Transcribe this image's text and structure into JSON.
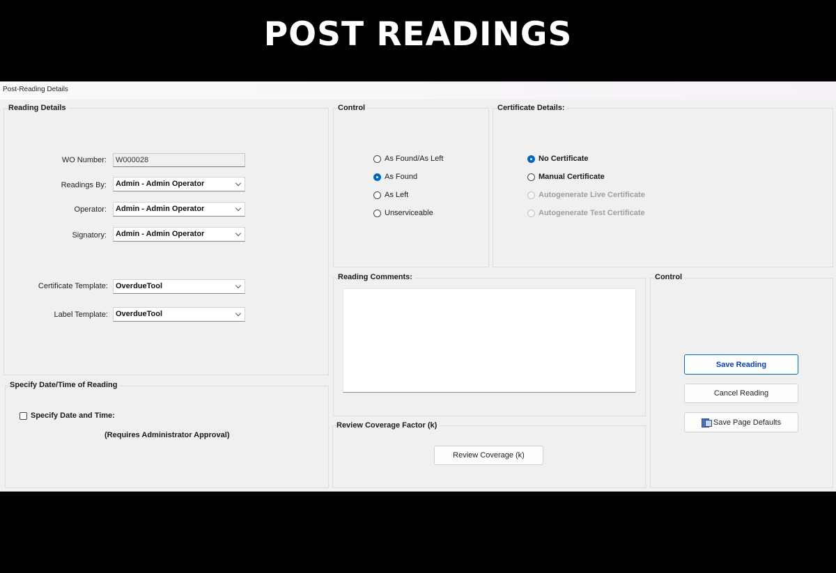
{
  "banner": {
    "title": "POST READINGS"
  },
  "window": {
    "title": "Post-Reading Details"
  },
  "reading_details": {
    "title": "Reading Details",
    "wo_number": {
      "label": "WO Number:",
      "value": "W000028"
    },
    "readings_by": {
      "label": "Readings By:",
      "value": "Admin - Admin Operator"
    },
    "operator": {
      "label": "Operator:",
      "value": "Admin - Admin Operator"
    },
    "signatory": {
      "label": "Signatory:",
      "value": "Admin - Admin Operator"
    },
    "certificate_template": {
      "label": "Certificate Template:",
      "value": "OverdueTool"
    },
    "label_template": {
      "label": "Label Template:",
      "value": "OverdueTool"
    }
  },
  "control_options": {
    "title": "Control",
    "options": [
      {
        "label": "As Found/As Left",
        "checked": false
      },
      {
        "label": "As Found",
        "checked": true
      },
      {
        "label": "As Left",
        "checked": false
      },
      {
        "label": "Unserviceable",
        "checked": false
      }
    ]
  },
  "certificate_details": {
    "title": "Certificate Details:",
    "options": [
      {
        "label": "No Certificate",
        "checked": true,
        "enabled": true
      },
      {
        "label": "Manual Certificate",
        "checked": false,
        "enabled": true
      },
      {
        "label": "Autogenerate Live Certificate",
        "checked": false,
        "enabled": false
      },
      {
        "label": "Autogenerate Test Certificate",
        "checked": false,
        "enabled": false
      }
    ]
  },
  "datetime": {
    "title": "Specify Date/Time of Reading",
    "checkbox_label": "Specify Date and Time:",
    "note": "(Requires Administrator Approval)"
  },
  "comments": {
    "title": "Reading Comments:",
    "value": ""
  },
  "coverage": {
    "title": "Review Coverage Factor (k)",
    "button": "Review Coverage (k)"
  },
  "actions": {
    "title": "Control",
    "save": "Save Reading",
    "cancel": "Cancel Reading",
    "defaults": "Save Page Defaults"
  }
}
